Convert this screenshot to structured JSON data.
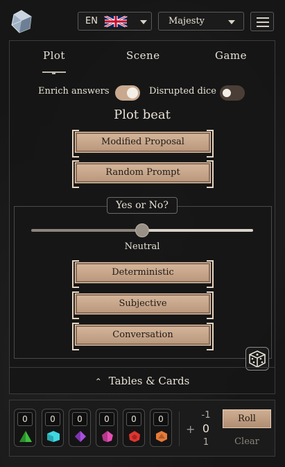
{
  "header": {
    "language_code": "EN",
    "language_flag": "uk-flag-icon",
    "system_select_value": "Majesty"
  },
  "tabs": [
    {
      "label": "Plot",
      "active": true
    },
    {
      "label": "Scene",
      "active": false
    },
    {
      "label": "Game",
      "active": false
    }
  ],
  "options": {
    "enrich_answers_label": "Enrich answers",
    "enrich_answers_on": true,
    "disrupted_dice_label": "Disrupted dice",
    "disrupted_dice_on": false
  },
  "plot_beat": {
    "title": "Plot beat",
    "buttons": [
      "Modified Proposal",
      "Random Prompt"
    ]
  },
  "yes_no": {
    "title": "Yes or No?",
    "slider_value": 0.5,
    "slider_label": "Neutral",
    "buttons": [
      "Deterministic",
      "Subjective",
      "Conversation"
    ]
  },
  "tables_cards_label": "Tables & Cards",
  "dice_tray": {
    "dice": [
      {
        "count": "0",
        "icon": "d4-icon",
        "color": "#3fbf3f"
      },
      {
        "count": "0",
        "icon": "d6-icon",
        "color": "#3fd6e0"
      },
      {
        "count": "0",
        "icon": "d8-icon",
        "color": "#a94fe0"
      },
      {
        "count": "0",
        "icon": "d10-icon",
        "color": "#e64fb4"
      },
      {
        "count": "0",
        "icon": "d12-icon",
        "color": "#e0352f"
      },
      {
        "count": "0",
        "icon": "d20-icon",
        "color": "#e57a3a"
      }
    ],
    "plus": "+",
    "modifier_up": "-1",
    "modifier_value": "0",
    "modifier_down": "1",
    "roll_label": "Roll",
    "clear_label": "Clear"
  },
  "colors": {
    "accent_button": "#c8a98f",
    "background": "#161616"
  }
}
